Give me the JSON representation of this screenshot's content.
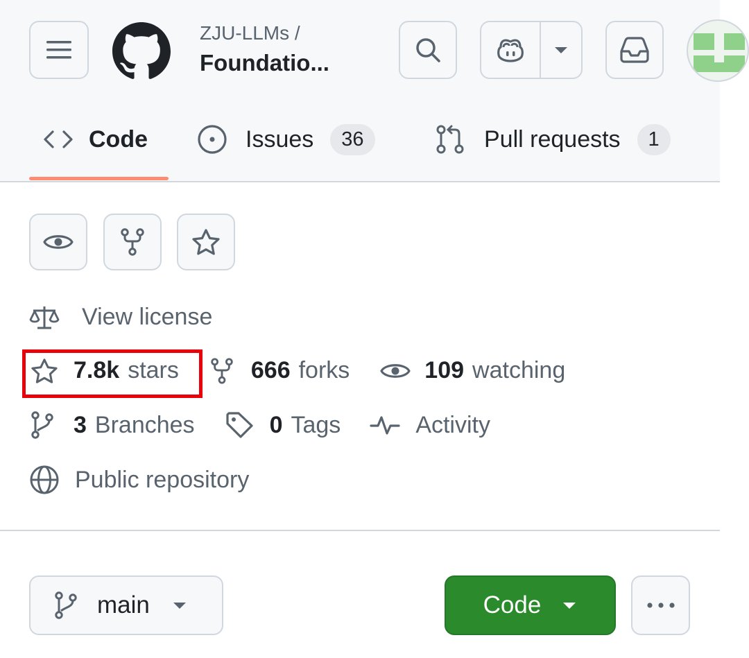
{
  "header": {
    "owner": "ZJU-LLMs /",
    "repo_name": "Foundatio..."
  },
  "tabs": [
    {
      "label": "Code",
      "counter": ""
    },
    {
      "label": "Issues",
      "counter": "36"
    },
    {
      "label": "Pull requests",
      "counter": "1"
    }
  ],
  "about": {
    "license": "View license",
    "stars_count": "7.8k",
    "stars_label": "stars",
    "forks_count": "666",
    "forks_label": "forks",
    "watching_count": "109",
    "watching_label": "watching",
    "branches_count": "3",
    "branches_label": "Branches",
    "tags_count": "0",
    "tags_label": "Tags",
    "activity_label": "Activity",
    "visibility": "Public repository"
  },
  "toolbar": {
    "branch": "main",
    "code_button": "Code"
  },
  "colors": {
    "accent_tab_underline": "#fd8c73",
    "code_button": "#2b8a2b",
    "highlight_box": "#e8000b"
  }
}
